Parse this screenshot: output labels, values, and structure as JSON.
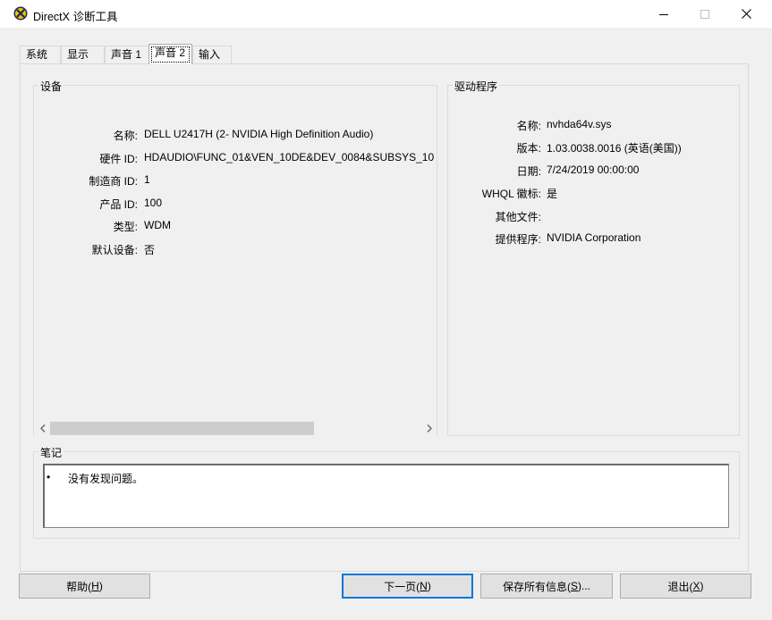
{
  "window": {
    "title": "DirectX 诊断工具"
  },
  "tabs": [
    {
      "label": "系统"
    },
    {
      "label": "显示"
    },
    {
      "label": "声音 1"
    },
    {
      "label": "声音 2",
      "active": true
    },
    {
      "label": "输入"
    }
  ],
  "device": {
    "group_title": "设备",
    "rows": [
      {
        "label": "名称:",
        "value": "DELL U2417H (2- NVIDIA High Definition Audio)"
      },
      {
        "label": "硬件 ID:",
        "value": "HDAUDIO\\FUNC_01&VEN_10DE&DEV_0084&SUBSYS_10"
      },
      {
        "label": "制造商 ID:",
        "value": "1"
      },
      {
        "label": "产品 ID:",
        "value": "100"
      },
      {
        "label": "类型:",
        "value": "WDM"
      },
      {
        "label": "默认设备:",
        "value": "否"
      }
    ]
  },
  "driver": {
    "group_title": "驱动程序",
    "rows": [
      {
        "label": "名称:",
        "value": "nvhda64v.sys"
      },
      {
        "label": "版本:",
        "value": "1.03.0038.0016 (英语(美国))"
      },
      {
        "label": "日期:",
        "value": "7/24/2019 00:00:00"
      },
      {
        "label": "WHQL 徽标:",
        "value": "是"
      },
      {
        "label": "其他文件:",
        "value": ""
      },
      {
        "label": "提供程序:",
        "value": "NVIDIA Corporation"
      }
    ]
  },
  "notes": {
    "group_title": "笔记",
    "bullet": "•",
    "items": [
      "没有发现问题。"
    ]
  },
  "buttons": {
    "help": {
      "text": "帮助(",
      "key": "H",
      "end": ")"
    },
    "next": {
      "text": "下一页(",
      "key": "N",
      "end": ")"
    },
    "save": {
      "text": "保存所有信息(",
      "key": "S",
      "end": ")..."
    },
    "exit": {
      "text": "退出(",
      "key": "X",
      "end": ")"
    }
  },
  "icons": {
    "app": "directx-icon",
    "minimize": "minimize-icon",
    "maximize": "maximize-icon",
    "close": "close-icon",
    "scroll_left": "chevron-left-icon",
    "scroll_right": "chevron-right-icon"
  },
  "colors": {
    "client_bg": "#f0f0f0",
    "default_button_border": "#0078d7",
    "app_icon_yellow": "#f2c200"
  }
}
